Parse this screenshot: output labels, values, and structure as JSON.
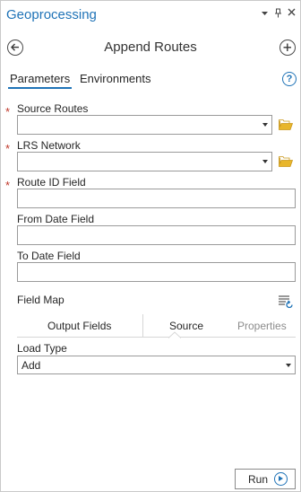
{
  "pane": {
    "title": "Geoprocessing",
    "controls": {
      "menu": "▾",
      "pin": "📌",
      "close": "✕"
    }
  },
  "tool": {
    "title": "Append Routes",
    "back_icon": "back-arrow-icon",
    "add_icon": "add-icon"
  },
  "tabs": [
    {
      "label": "Parameters",
      "active": true
    },
    {
      "label": "Environments",
      "active": false
    }
  ],
  "help": "?",
  "params": {
    "source_routes": {
      "label": "Source Routes",
      "required": "*",
      "value": ""
    },
    "lrs_network": {
      "label": "LRS Network",
      "required": "*",
      "value": ""
    },
    "route_id_field": {
      "label": "Route ID Field",
      "required": "*",
      "value": ""
    },
    "from_date_field": {
      "label": "From Date Field",
      "value": ""
    },
    "to_date_field": {
      "label": "To Date Field",
      "value": ""
    }
  },
  "field_map": {
    "label": "Field Map",
    "tabs": [
      "Output Fields",
      "Source",
      "Properties"
    ]
  },
  "load_type": {
    "label": "Load Type",
    "value": "Add"
  },
  "run": {
    "label": "Run"
  },
  "colors": {
    "accent": "#1f73b7",
    "required": "#c0392b",
    "folder": "#e8b62c"
  }
}
